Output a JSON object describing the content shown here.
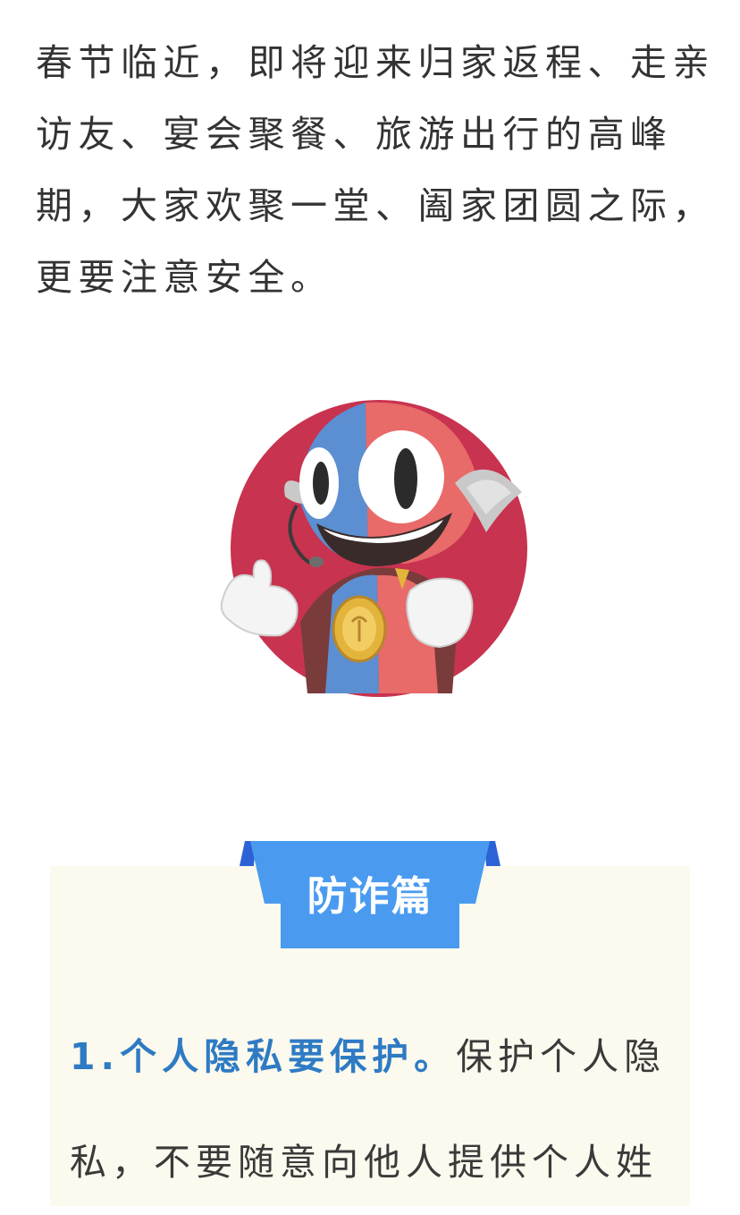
{
  "intro": {
    "text": "春节临近，即将迎来归家返程、走亲访友、宴会聚餐、旅游出行的高峰期，大家欢聚一堂、阖家团圆之际，更要注意安全。"
  },
  "mascot": {
    "icon": "mascot-illustration",
    "colors": {
      "circle": "#c8334f",
      "red": "#e86a69",
      "blue": "#5b8fd1",
      "gold": "#e3b43b"
    }
  },
  "section": {
    "title": "防诈篇",
    "colors": {
      "banner": "#4a9bf0",
      "banner_dark": "#2b63d6",
      "card_bg": "#fcf9ee",
      "highlight": "#2e7bc4"
    },
    "item": {
      "heading": "1.个人隐私要保护。",
      "body": "保护个人隐私，不要随意向他人提供个人姓"
    }
  }
}
